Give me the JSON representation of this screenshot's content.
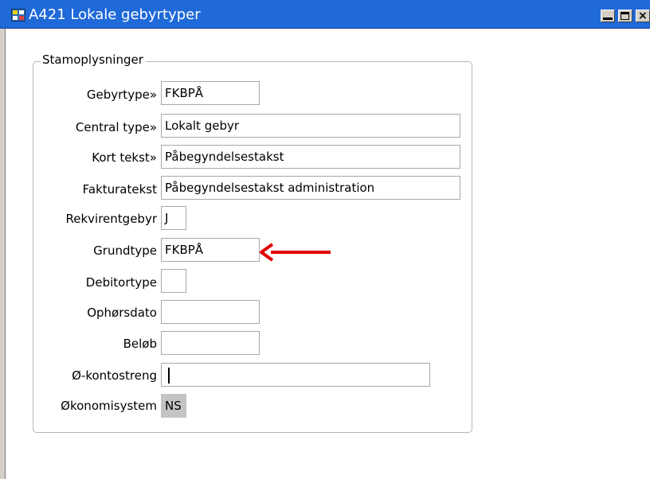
{
  "window": {
    "title": "A421 Lokale gebyrtyper",
    "icon": "forms-app-icon",
    "controls": [
      "minimize-icon",
      "maximize-icon",
      "close-icon"
    ]
  },
  "group": {
    "title": "Stamoplysninger"
  },
  "fields": {
    "gebyrtype": {
      "label": "Gebyrtype»",
      "value": "FKBPÅ"
    },
    "central_type": {
      "label": "Central type»",
      "value": "Lokalt gebyr"
    },
    "kort_tekst": {
      "label": "Kort tekst»",
      "value": "Påbegyndelsestakst"
    },
    "fakturatekst": {
      "label": "Fakturatekst",
      "value": "Påbegyndelsestakst administration"
    },
    "rekvirentgebyr": {
      "label": "Rekvirentgebyr",
      "value": "J"
    },
    "grundtype": {
      "label": "Grundtype",
      "value": "FKBPÅ"
    },
    "debitortype": {
      "label": "Debitortype",
      "value": ""
    },
    "ophorsdato": {
      "label": "Ophørsdato",
      "value": ""
    },
    "belob": {
      "label": "Beløb",
      "value": ""
    },
    "kontostreng": {
      "label": "Ø-kontostreng",
      "value": ""
    },
    "okonomisystem": {
      "label": "Økonomisystem",
      "value": "NS"
    }
  },
  "annotation": {
    "icon": "red-arrow-icon",
    "color": "#e00000"
  },
  "colors": {
    "titlebar": "#1f69d8",
    "readonly_field": "#c4c4c4"
  }
}
